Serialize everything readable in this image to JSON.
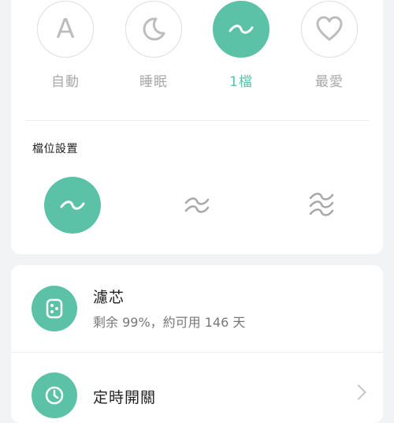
{
  "colors": {
    "accent": "#5cc2a7",
    "background": "#f2f3f5",
    "card": "#ffffff",
    "muted_text": "#a8a8a8"
  },
  "modes": [
    {
      "label": "自動",
      "icon": "auto-letter-icon",
      "glyph": "A",
      "active": false
    },
    {
      "label": "睡眠",
      "icon": "moon-icon",
      "active": false
    },
    {
      "label": "1檔",
      "icon": "wave-icon",
      "active": true
    },
    {
      "label": "最愛",
      "icon": "heart-icon",
      "active": false
    }
  ],
  "fan_levels": {
    "title": "檔位設置",
    "levels": [
      {
        "icon": "wave-1-icon",
        "active": true
      },
      {
        "icon": "wave-2-icon",
        "active": false
      },
      {
        "icon": "wave-3-icon",
        "active": false
      }
    ]
  },
  "filter": {
    "title": "濾芯",
    "status": "剩余 99%，約可用 146 天",
    "icon": "filter-icon"
  },
  "timer": {
    "title": "定時開關",
    "icon": "clock-icon"
  }
}
